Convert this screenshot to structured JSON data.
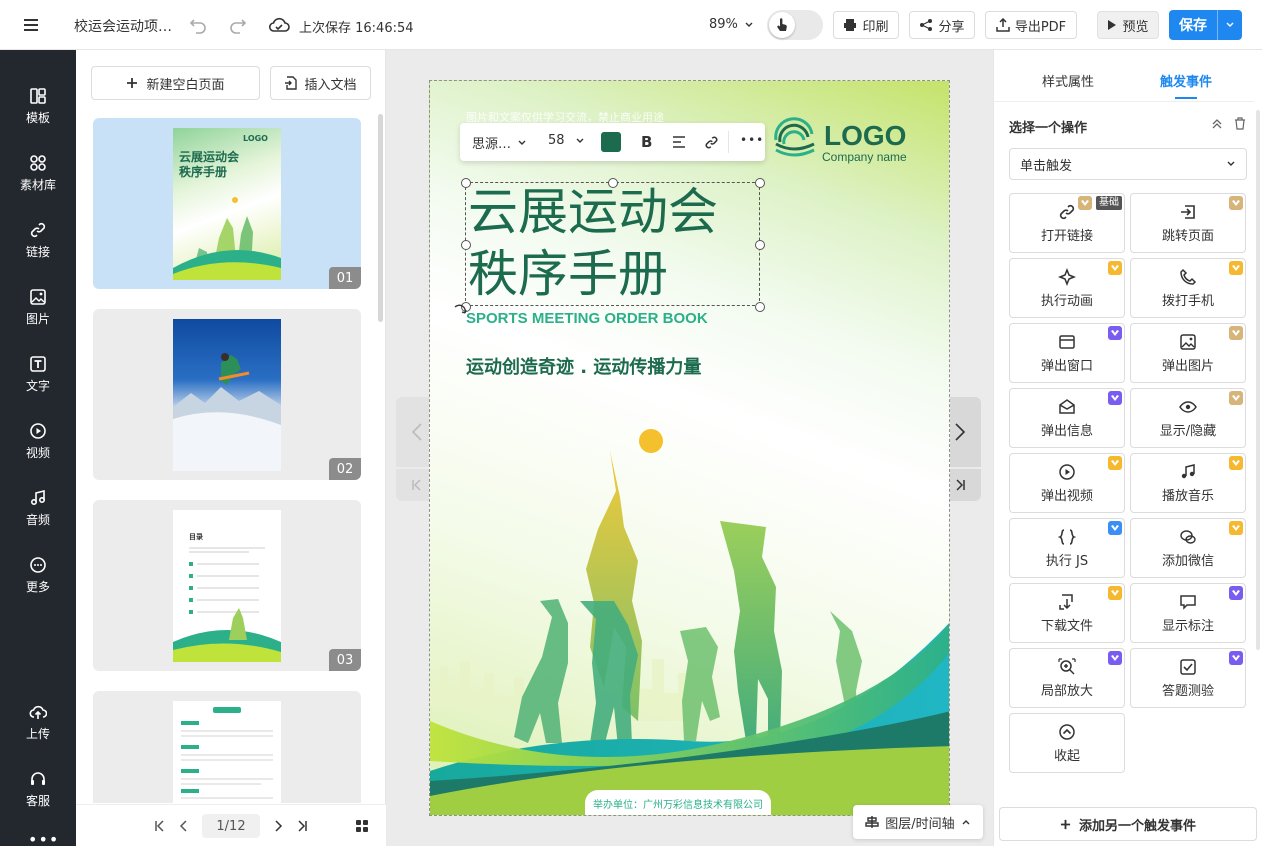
{
  "topbar": {
    "title": "校运会运动项…",
    "save_status": "上次保存 16:46:54",
    "zoom": "89%",
    "print_label": "印刷",
    "share_label": "分享",
    "export_label": "导出PDF",
    "preview_label": "预览",
    "save_label": "保存"
  },
  "leftnav": {
    "items": [
      {
        "label": "模板"
      },
      {
        "label": "素材库"
      },
      {
        "label": "链接"
      },
      {
        "label": "图片"
      },
      {
        "label": "文字"
      },
      {
        "label": "视频"
      },
      {
        "label": "音频"
      },
      {
        "label": "更多"
      },
      {
        "label": "上传"
      },
      {
        "label": "客服"
      }
    ]
  },
  "pages": {
    "new_page_label": "新建空白页面",
    "insert_doc_label": "插入文档",
    "thumbs": [
      {
        "num": "01",
        "title1": "云展运动会",
        "title2": "秩序手册"
      },
      {
        "num": "02"
      },
      {
        "num": "03",
        "toc_title": "目录"
      },
      {
        "num": ""
      }
    ],
    "pagination": "1/12"
  },
  "canvas": {
    "watermark": "图片和文案仅供学习交流，禁止商业用途",
    "font_name": "思源…",
    "font_size": "58",
    "text_color": "#1d6b4f",
    "title_line1": "云展运动会",
    "title_line2": "秩序手册",
    "subtitle_en": "SPORTS MEETING ORDER BOOK",
    "slogan": "运动创造奇迹 . 运动传播力量",
    "logo_text": "LOGO",
    "logo_sub": "Company name",
    "organizer": "举办单位：广州万彩信息技术有限公司",
    "layers_label": "图层/时间轴"
  },
  "rightpanel": {
    "tab_style": "样式属性",
    "tab_trigger": "触发事件",
    "section_title": "选择一个操作",
    "trigger_select": "单击触发",
    "basic_badge": "基础",
    "actions": [
      {
        "label": "打开链接",
        "icon": "link-icon",
        "badge": "tan"
      },
      {
        "label": "跳转页面",
        "icon": "jump-page-icon",
        "badge": "tan"
      },
      {
        "label": "执行动画",
        "icon": "sparkle-icon",
        "badge": "gold"
      },
      {
        "label": "拨打手机",
        "icon": "phone-icon",
        "badge": "gold"
      },
      {
        "label": "弹出窗口",
        "icon": "window-icon",
        "badge": "purple"
      },
      {
        "label": "弹出图片",
        "icon": "image-icon",
        "badge": "tan"
      },
      {
        "label": "弹出信息",
        "icon": "envelope-icon",
        "badge": "purple"
      },
      {
        "label": "显示/隐藏",
        "icon": "eye-icon",
        "badge": "tan"
      },
      {
        "label": "弹出视频",
        "icon": "play-icon",
        "badge": "gold"
      },
      {
        "label": "播放音乐",
        "icon": "music-icon",
        "badge": "gold"
      },
      {
        "label": "执行 JS",
        "icon": "braces-icon",
        "badge": "blue"
      },
      {
        "label": "添加微信",
        "icon": "wechat-icon",
        "badge": "gold"
      },
      {
        "label": "下载文件",
        "icon": "download-icon",
        "badge": "gold"
      },
      {
        "label": "显示标注",
        "icon": "comment-icon",
        "badge": "purple"
      },
      {
        "label": "局部放大",
        "icon": "zoom-icon",
        "badge": "purple"
      },
      {
        "label": "答题测验",
        "icon": "quiz-icon",
        "badge": "purple"
      },
      {
        "label": "收起",
        "icon": "collapse-icon",
        "badge": ""
      }
    ],
    "add_trigger_label": "添加另一个触发事件"
  },
  "colors": {
    "primary": "#1e88f0",
    "dark_nav": "#23272e",
    "title_green": "#1d6b4f",
    "accent_green": "#2bb08a"
  }
}
